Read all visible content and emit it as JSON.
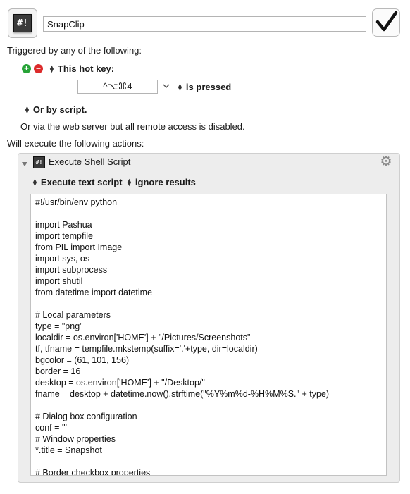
{
  "macro": {
    "icon_text": "#!",
    "name": "SnapClip",
    "enabled_icon": "checkmark-icon"
  },
  "triggers": {
    "heading": "Triggered by any of the following:",
    "add_icon": "plus-circle-icon",
    "remove_icon": "minus-circle-icon",
    "hotkey_trigger_label": "This hot key:",
    "hotkey": "^⌥⌘4",
    "hotkey_dropdown_icon": "chevron-down-icon",
    "hotkey_condition": "is pressed",
    "script_trigger_label": "Or by script.",
    "web_server_note": "Or via the web server but all remote access is disabled."
  },
  "actions": {
    "heading": "Will execute the following actions:",
    "items": [
      {
        "title": "Execute Shell Script",
        "icon_text": "#!",
        "gear_icon": "gear-icon",
        "source_option": "Execute text script",
        "results_option": "ignore results",
        "script_lines": [
          "#!/usr/bin/env python",
          "",
          "import Pashua",
          "import tempfile",
          "from PIL import Image",
          "import sys, os",
          "import subprocess",
          "import shutil",
          "from datetime import datetime",
          "",
          "# Local parameters",
          "type = \"png\"",
          "localdir = os.environ['HOME'] + \"/Pictures/Screenshots\"",
          "tf, tfname = tempfile.mkstemp(suffix='.'+type, dir=localdir)",
          "bgcolor = (61, 101, 156)",
          "border = 16",
          "desktop = os.environ['HOME'] + \"/Desktop/\"",
          "fname = desktop + datetime.now().strftime(\"%Y%m%d-%H%M%S.\" + type)",
          "",
          "# Dialog box configuration",
          "conf = '''",
          "# Window properties",
          "*.title = Snapshot",
          "",
          "# Border checkbox properties"
        ]
      }
    ]
  }
}
